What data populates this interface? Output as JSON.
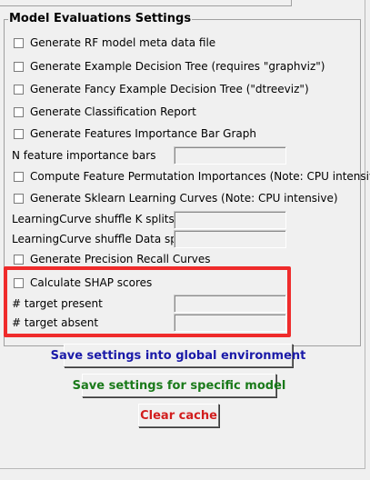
{
  "group": {
    "title": "Model Evaluations Settings"
  },
  "checkboxes": {
    "rf_meta": "Generate RF model meta data file",
    "example_tree": "Generate Example Decision Tree (requires \"graphviz\")",
    "fancy_tree": "Generate Fancy Example Decision Tree (\"dtreeviz\")",
    "class_report": "Generate Classification Report",
    "feat_importance": "Generate Features Importance Bar Graph",
    "permutation": "Compute Feature Permutation Importances (Note: CPU intensive)",
    "learning_curves": "Generate Sklearn Learning Curves (Note: CPU intensive)",
    "precision_recall": "Generate Precision Recall Curves",
    "shap": "Calculate SHAP scores"
  },
  "fields": {
    "n_feature_bars": {
      "label": "N feature importance bars",
      "value": ""
    },
    "lc_k_splits": {
      "label": "LearningCurve shuffle K splits",
      "value": ""
    },
    "lc_data_splits": {
      "label": "LearningCurve shuffle Data splits",
      "value": ""
    },
    "target_present": {
      "label": "# target present",
      "value": ""
    },
    "target_absent": {
      "label": "# target absent",
      "value": ""
    }
  },
  "buttons": {
    "save_global": "Save settings into global environment",
    "save_model": "Save settings for specific model",
    "clear_cache": "Clear cache"
  },
  "colors": {
    "highlight": "#ef2b2b",
    "save_global": "#1a1aa8",
    "save_model": "#1a7a1a",
    "clear_cache": "#d21e1e"
  }
}
